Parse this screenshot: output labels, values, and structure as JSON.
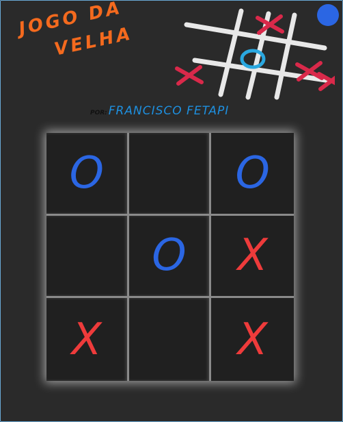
{
  "logo": {
    "line1": "JOGO DA",
    "line2": "VELHA",
    "mini_board": [
      "X",
      "O",
      "X",
      "X",
      "X"
    ]
  },
  "credit": {
    "by": "POR:",
    "name": "FRANCISCO FETAPI"
  },
  "board": {
    "cells": [
      "O",
      "",
      "O",
      "",
      "O",
      "X",
      "X",
      "",
      "X"
    ]
  },
  "colors": {
    "background": "#2a2a2a",
    "title": "#f46a1e",
    "credit": "#1e90e0",
    "o": "#2b66e3",
    "x": "#ee3b3b",
    "mini_x": "#d9294a",
    "mini_o": "#2aa8e0",
    "status_dot": "#2b66e3"
  }
}
